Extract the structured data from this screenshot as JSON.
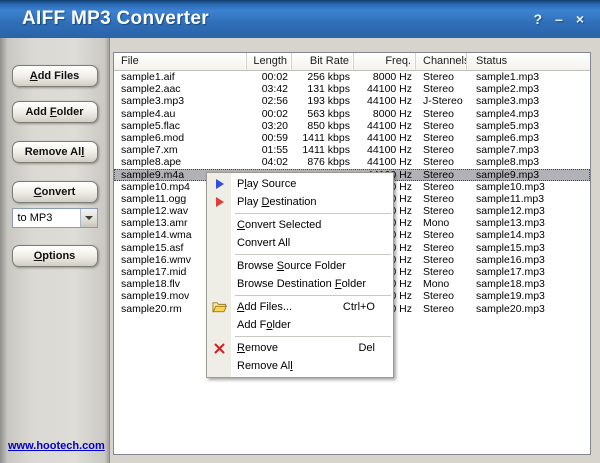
{
  "window": {
    "title": "AIFF MP3 Converter",
    "help": "?",
    "minimize": "–",
    "close": "×"
  },
  "colors": {
    "titlebar_blue": "#2f6fb8",
    "selection_gray": "#b2b1b7",
    "link_blue": "#0000cc",
    "play_source_icon": "#2f4fd8",
    "play_destination_icon": "#e03c3c",
    "remove_icon": "#cc2222",
    "folder_icon": "#ffd24d"
  },
  "sidebar": {
    "add_files": {
      "pre": "",
      "key": "A",
      "post": "dd Files"
    },
    "add_folder": {
      "pre": "Add ",
      "key": "F",
      "post": "older"
    },
    "remove_all": {
      "pre": "Remove Al",
      "key": "l",
      "post": ""
    },
    "convert": {
      "pre": "",
      "key": "C",
      "post": "onvert"
    },
    "format_select": {
      "value": "to MP3"
    },
    "options": {
      "pre": "",
      "key": "O",
      "post": "ptions"
    },
    "link": "www.hootech.com"
  },
  "table": {
    "columns": [
      {
        "label": "File",
        "align": "left"
      },
      {
        "label": "Length",
        "align": "right"
      },
      {
        "label": "Bit Rate",
        "align": "right"
      },
      {
        "label": "Freq.",
        "align": "right"
      },
      {
        "label": "Channels",
        "align": "left"
      },
      {
        "label": "Status",
        "align": "left"
      }
    ],
    "rows": [
      {
        "file": "sample1.aif",
        "length": "00:02",
        "bitrate": "256 kbps",
        "freq": "8000 Hz",
        "channels": "Stereo",
        "status": "sample1.mp3",
        "selected": false
      },
      {
        "file": "sample2.aac",
        "length": "03:42",
        "bitrate": "131 kbps",
        "freq": "44100 Hz",
        "channels": "Stereo",
        "status": "sample2.mp3",
        "selected": false
      },
      {
        "file": "sample3.mp3",
        "length": "02:56",
        "bitrate": "193 kbps",
        "freq": "44100 Hz",
        "channels": "J-Stereo",
        "status": "sample3.mp3",
        "selected": false
      },
      {
        "file": "sample4.au",
        "length": "00:02",
        "bitrate": "563 kbps",
        "freq": "8000 Hz",
        "channels": "Stereo",
        "status": "sample4.mp3",
        "selected": false
      },
      {
        "file": "sample5.flac",
        "length": "03:20",
        "bitrate": "850 kbps",
        "freq": "44100 Hz",
        "channels": "Stereo",
        "status": "sample5.mp3",
        "selected": false
      },
      {
        "file": "sample6.mod",
        "length": "00:59",
        "bitrate": "1411 kbps",
        "freq": "44100 Hz",
        "channels": "Stereo",
        "status": "sample6.mp3",
        "selected": false
      },
      {
        "file": "sample7.xm",
        "length": "01:55",
        "bitrate": "1411 kbps",
        "freq": "44100 Hz",
        "channels": "Stereo",
        "status": "sample7.mp3",
        "selected": false
      },
      {
        "file": "sample8.ape",
        "length": "04:02",
        "bitrate": "876 kbps",
        "freq": "44100 Hz",
        "channels": "Stereo",
        "status": "sample8.mp3",
        "selected": false
      },
      {
        "file": "sample9.m4a",
        "length": "",
        "bitrate": "",
        "freq": "44100 Hz",
        "channels": "Stereo",
        "status": "sample9.mp3",
        "selected": true
      },
      {
        "file": "sample10.mp4",
        "length": "",
        "bitrate": "",
        "freq": "44100 Hz",
        "channels": "Stereo",
        "status": "sample10.mp3",
        "selected": false
      },
      {
        "file": "sample11.ogg",
        "length": "",
        "bitrate": "",
        "freq": "44100 Hz",
        "channels": "Stereo",
        "status": "sample11.mp3",
        "selected": false
      },
      {
        "file": "sample12.wav",
        "length": "",
        "bitrate": "",
        "freq": "44100 Hz",
        "channels": "Stereo",
        "status": "sample12.mp3",
        "selected": false
      },
      {
        "file": "sample13.amr",
        "length": "",
        "bitrate": "",
        "freq": "44100 Hz",
        "channels": "Mono",
        "status": "sample13.mp3",
        "selected": false
      },
      {
        "file": "sample14.wma",
        "length": "",
        "bitrate": "",
        "freq": "44100 Hz",
        "channels": "Stereo",
        "status": "sample14.mp3",
        "selected": false
      },
      {
        "file": "sample15.asf",
        "length": "",
        "bitrate": "",
        "freq": "44100 Hz",
        "channels": "Stereo",
        "status": "sample15.mp3",
        "selected": false
      },
      {
        "file": "sample16.wmv",
        "length": "",
        "bitrate": "",
        "freq": "44100 Hz",
        "channels": "Stereo",
        "status": "sample16.mp3",
        "selected": false
      },
      {
        "file": "sample17.mid",
        "length": "",
        "bitrate": "",
        "freq": "44100 Hz",
        "channels": "Stereo",
        "status": "sample17.mp3",
        "selected": false
      },
      {
        "file": "sample18.flv",
        "length": "",
        "bitrate": "",
        "freq": "44100 Hz",
        "channels": "Mono",
        "status": "sample18.mp3",
        "selected": false
      },
      {
        "file": "sample19.mov",
        "length": "",
        "bitrate": "",
        "freq": "44100 Hz",
        "channels": "Stereo",
        "status": "sample19.mp3",
        "selected": false
      },
      {
        "file": "sample20.rm",
        "length": "",
        "bitrate": "",
        "freq": "44100 Hz",
        "channels": "Stereo",
        "status": "sample20.mp3",
        "selected": false
      }
    ]
  },
  "menu": {
    "items": [
      {
        "id": "play-source",
        "pre": "P",
        "key": "l",
        "post": "ay Source",
        "icon": "play-source",
        "separator_after": false
      },
      {
        "id": "play-destination",
        "pre": "Play ",
        "key": "D",
        "post": "estination",
        "icon": "play-destination",
        "separator_after": true
      },
      {
        "id": "convert-selected",
        "pre": "",
        "key": "C",
        "post": "onvert Selected",
        "separator_after": false
      },
      {
        "id": "convert-all",
        "pre": "Convert All",
        "key": "",
        "post": "",
        "separator_after": true
      },
      {
        "id": "browse-source-folder",
        "pre": "Browse ",
        "key": "S",
        "post": "ource Folder",
        "separator_after": false
      },
      {
        "id": "browse-destination-folder",
        "pre": "Browse Destination ",
        "key": "F",
        "post": "older",
        "separator_after": true
      },
      {
        "id": "add-files",
        "pre": "",
        "key": "A",
        "post": "dd Files...",
        "icon": "folder-open",
        "shortcut": "Ctrl+O",
        "separator_after": false
      },
      {
        "id": "add-folder",
        "pre": "Add F",
        "key": "o",
        "post": "lder",
        "separator_after": true
      },
      {
        "id": "remove",
        "pre": "",
        "key": "R",
        "post": "emove",
        "icon": "remove",
        "shortcut": "Del",
        "separator_after": false
      },
      {
        "id": "remove-all",
        "pre": "Remove Al",
        "key": "l",
        "post": "",
        "separator_after": false
      }
    ]
  }
}
